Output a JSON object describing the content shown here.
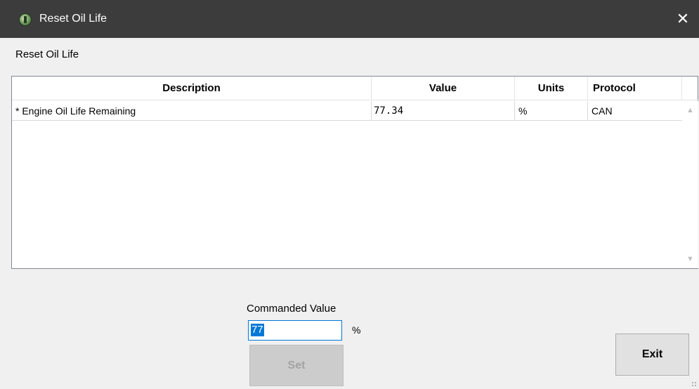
{
  "window": {
    "title": "Reset Oil Life",
    "close_glyph": "✕"
  },
  "header": {
    "label": "Reset Oil Life"
  },
  "table": {
    "columns": [
      "Description",
      "Value",
      "Units",
      "Protocol"
    ],
    "rows": [
      {
        "description": "* Engine Oil Life Remaining",
        "value": "77.34",
        "units": "%",
        "protocol": "CAN"
      }
    ],
    "scroll_up_glyph": "▲",
    "scroll_down_glyph": "▼"
  },
  "commanded": {
    "label": "Commanded Value",
    "input_value": "77",
    "unit": "%"
  },
  "buttons": {
    "set_label": "Set",
    "exit_label": "Exit"
  },
  "colors": {
    "titlebar": "#3c3c3c",
    "selection": "#0078d7",
    "disabled_button": "#cccccc"
  },
  "icons": {
    "app": "app-logo-icon",
    "close": "close-icon",
    "scroll_up": "chevron-up-icon",
    "scroll_down": "chevron-down-icon",
    "grip": "resize-grip-icon"
  }
}
